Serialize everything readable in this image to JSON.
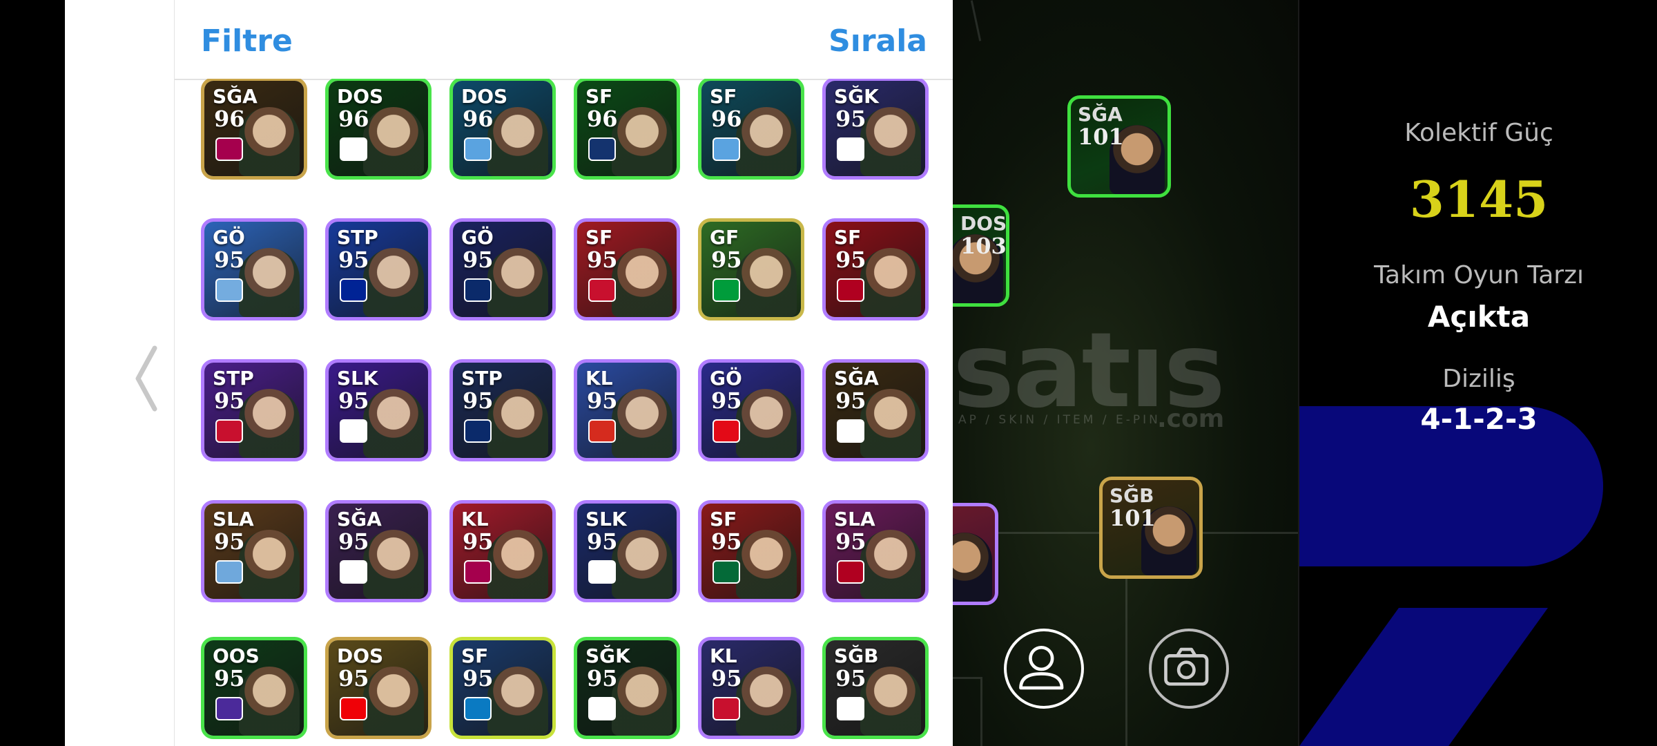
{
  "header": {
    "filter_label": "Filtre",
    "sort_label": "Sırala"
  },
  "cards": [
    {
      "pos": "SĞA",
      "rating": "96",
      "bg": "#3a2a12",
      "border": "#c9a44a",
      "badge": "#a5004d"
    },
    {
      "pos": "DOS",
      "rating": "96",
      "bg": "#0b3a12",
      "border": "#49e34a",
      "badge": "#ffffff"
    },
    {
      "pos": "DOS",
      "rating": "96",
      "bg": "#0d4a6a",
      "border": "#49e34a",
      "badge": "#5aa3e0"
    },
    {
      "pos": "SF",
      "rating": "96",
      "bg": "#0b4a16",
      "border": "#49e34a",
      "badge": "#14336e"
    },
    {
      "pos": "SF",
      "rating": "96",
      "bg": "#0e4a5a",
      "border": "#49e34a",
      "badge": "#5aa3e0"
    },
    {
      "pos": "SĞK",
      "rating": "95",
      "bg": "#2a2a6a",
      "border": "#b07cff",
      "badge": "#ffffff"
    },
    {
      "pos": "GÖ",
      "rating": "95",
      "bg": "#2c63b8",
      "border": "#b07cff",
      "badge": "#74acdf"
    },
    {
      "pos": "STP",
      "rating": "95",
      "bg": "#173a9a",
      "border": "#b07cff",
      "badge": "#002395"
    },
    {
      "pos": "GÖ",
      "rating": "95",
      "bg": "#1a2260",
      "border": "#b07cff",
      "badge": "#0b2a6a"
    },
    {
      "pos": "SF",
      "rating": "95",
      "bg": "#a01a22",
      "border": "#b07cff",
      "badge": "#c8102e"
    },
    {
      "pos": "GF",
      "rating": "95",
      "bg": "#2d6b24",
      "border": "#c9b84a",
      "badge": "#009c3b"
    },
    {
      "pos": "SF",
      "rating": "95",
      "bg": "#8a1018",
      "border": "#b07cff",
      "badge": "#b00020"
    },
    {
      "pos": "STP",
      "rating": "95",
      "bg": "#4a1e8a",
      "border": "#b07cff",
      "badge": "#c8102e"
    },
    {
      "pos": "SLK",
      "rating": "95",
      "bg": "#3a1a8a",
      "border": "#b07cff",
      "badge": "#ffffff"
    },
    {
      "pos": "STP",
      "rating": "95",
      "bg": "#1a2a55",
      "border": "#b07cff",
      "badge": "#0b2a6a"
    },
    {
      "pos": "KL",
      "rating": "95",
      "bg": "#2a4aa0",
      "border": "#b07cff",
      "badge": "#d52b1e"
    },
    {
      "pos": "GÖ",
      "rating": "95",
      "bg": "#2a2a8a",
      "border": "#b07cff",
      "badge": "#e30a17"
    },
    {
      "pos": "SĞA",
      "rating": "95",
      "bg": "#3a2a12",
      "border": "#b07cff",
      "badge": "#ffffff"
    },
    {
      "pos": "SLA",
      "rating": "95",
      "bg": "#5a3a1a",
      "border": "#b07cff",
      "badge": "#6fa8dc"
    },
    {
      "pos": "SĞA",
      "rating": "95",
      "bg": "#3a2050",
      "border": "#b07cff",
      "badge": "#ffffff"
    },
    {
      "pos": "KL",
      "rating": "95",
      "bg": "#a01a2a",
      "border": "#b07cff",
      "badge": "#a5004d"
    },
    {
      "pos": "SLK",
      "rating": "95",
      "bg": "#1a2a6a",
      "border": "#b07cff",
      "badge": "#ffffff"
    },
    {
      "pos": "SF",
      "rating": "95",
      "bg": "#8a1a1a",
      "border": "#b07cff",
      "badge": "#046a38"
    },
    {
      "pos": "SLA",
      "rating": "95",
      "bg": "#6a1a5a",
      "border": "#b07cff",
      "badge": "#b00020"
    },
    {
      "pos": "OOS",
      "rating": "95",
      "bg": "#0e3a18",
      "border": "#49e34a",
      "badge": "#4b2a9a"
    },
    {
      "pos": "DOS",
      "rating": "95",
      "bg": "#5a4a1a",
      "border": "#c9a44a",
      "badge": "#ef0107"
    },
    {
      "pos": "SF",
      "rating": "95",
      "bg": "#1a3a6a",
      "border": "#c8e23a",
      "badge": "#0a7ac2"
    },
    {
      "pos": "SĞK",
      "rating": "95",
      "bg": "#102a18",
      "border": "#49e34a",
      "badge": "#ffffff"
    },
    {
      "pos": "KL",
      "rating": "95",
      "bg": "#2a2a6a",
      "border": "#b07cff",
      "badge": "#c8102e"
    },
    {
      "pos": "SĞB",
      "rating": "95",
      "bg": "#2a2a2a",
      "border": "#49e34a",
      "badge": "#ffffff"
    }
  ],
  "pitch": {
    "players": [
      {
        "pos": "SĞA",
        "rating": "101"
      },
      {
        "pos": "DOS",
        "rating": "103"
      },
      {
        "pos": "SĞB",
        "rating": "101"
      }
    ],
    "watermark": "satıs",
    "watermark_sub": "AP / SKIN / ITEM / E-PIN",
    "watermark_com": ".com"
  },
  "stats": {
    "collective_label": "Kolektif Güç",
    "collective_value": "3145",
    "collective_color": "#d8d21a",
    "style_label": "Takım Oyun Tarzı",
    "style_value": "Açıkta",
    "formation_label": "Diziliş",
    "formation_value": "4-1-2-3"
  }
}
